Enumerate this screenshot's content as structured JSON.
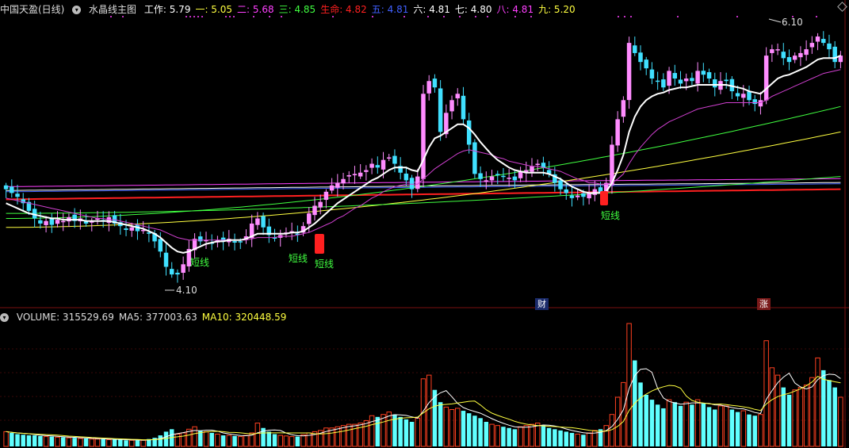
{
  "header": {
    "stock_name": "中国天盈(日线)",
    "indicator_name": "水晶线主图",
    "items": [
      {
        "label": "工作:",
        "value": "5.79",
        "color": "#ffffff"
      },
      {
        "label": "一:",
        "value": "5.05",
        "color": "#ffff40"
      },
      {
        "label": "二:",
        "value": "5.68",
        "color": "#ff40ff"
      },
      {
        "label": "三:",
        "value": "4.85",
        "color": "#40ff40"
      },
      {
        "label": "生命:",
        "value": "4.82",
        "color": "#ff2020"
      },
      {
        "label": "五:",
        "value": "4.81",
        "color": "#4060ff"
      },
      {
        "label": "六:",
        "value": "4.81",
        "color": "#ffffff"
      },
      {
        "label": "七:",
        "value": "4.80",
        "color": "#ffffff"
      },
      {
        "label": "八:",
        "value": "4.81",
        "color": "#ff40ff"
      },
      {
        "label": "九:",
        "value": "5.20",
        "color": "#ffff40"
      }
    ]
  },
  "volume_header": {
    "items": [
      {
        "label": "VOLUME:",
        "value": "315529.69",
        "color": "#dddddd"
      },
      {
        "label": "MA5:",
        "value": "377003.63",
        "color": "#dddddd"
      },
      {
        "label": "MA10:",
        "value": "320448.59",
        "color": "#ffff40"
      }
    ]
  },
  "annotations": {
    "low_label": "4.10",
    "high_label": "6.10",
    "signal_label": "短线",
    "event_cai": "财",
    "event_zhang": "涨"
  },
  "colors": {
    "up": "#ff8cff",
    "down": "#40e0ff",
    "up_volume": "#ff4020",
    "down_volume": "#60ffff",
    "background": "#000000",
    "grid": "#7a1010"
  },
  "chart_data": {
    "type": "candlestick",
    "price_range": [
      4.0,
      6.2
    ],
    "closes": [
      4.85,
      4.82,
      4.79,
      4.74,
      4.68,
      4.62,
      4.58,
      4.6,
      4.57,
      4.61,
      4.6,
      4.63,
      4.6,
      4.62,
      4.58,
      4.6,
      4.62,
      4.6,
      4.63,
      4.58,
      4.56,
      4.53,
      4.55,
      4.52,
      4.53,
      4.5,
      4.44,
      4.36,
      4.24,
      4.18,
      4.18,
      4.26,
      4.38,
      4.46,
      4.44,
      4.45,
      4.43,
      4.45,
      4.44,
      4.46,
      4.43,
      4.44,
      4.48,
      4.58,
      4.62,
      4.55,
      4.49,
      4.47,
      4.49,
      4.51,
      4.52,
      4.5,
      4.56,
      4.66,
      4.72,
      4.75,
      4.83,
      4.88,
      4.9,
      4.93,
      4.96,
      4.97,
      4.98,
      5.0,
      5.05,
      5.02,
      5.08,
      5.1,
      5.05,
      4.98,
      4.92,
      4.85,
      4.95,
      5.6,
      5.7,
      5.65,
      5.3,
      5.45,
      5.55,
      5.6,
      5.4,
      5.2,
      4.97,
      4.93,
      4.92,
      4.95,
      4.96,
      4.95,
      4.94,
      4.92,
      4.99,
      5.0,
      5.03,
      5.05,
      5.02,
      4.97,
      4.9,
      4.85,
      4.82,
      4.78,
      4.8,
      4.79,
      4.82,
      4.85,
      4.82,
      4.9,
      5.2,
      5.4,
      5.55,
      6.0,
      5.92,
      5.85,
      5.8,
      5.72,
      5.7,
      5.65,
      5.78,
      5.72,
      5.68,
      5.72,
      5.7,
      5.78,
      5.75,
      5.72,
      5.65,
      5.7,
      5.7,
      5.62,
      5.58,
      5.6,
      5.55,
      5.52,
      5.55,
      5.9,
      5.95,
      5.95,
      5.88,
      5.85,
      5.9,
      5.92,
      5.95,
      6.0,
      6.05,
      6.0,
      5.95,
      5.85,
      5.9
    ],
    "work_line": [
      4.74,
      4.72,
      4.7,
      4.68,
      4.66,
      4.65,
      4.64,
      4.63,
      4.62,
      4.62,
      4.61,
      4.61,
      4.61,
      4.61,
      4.6,
      4.6,
      4.6,
      4.6,
      4.6,
      4.59,
      4.58,
      4.57,
      4.56,
      4.55,
      4.54,
      4.52,
      4.5,
      4.47,
      4.43,
      4.39,
      4.36,
      4.35,
      4.36,
      4.38,
      4.4,
      4.42,
      4.43,
      4.44,
      4.44,
      4.45,
      4.45,
      4.45,
      4.46,
      4.48,
      4.5,
      4.5,
      4.5,
      4.5,
      4.5,
      4.5,
      4.51,
      4.51,
      4.52,
      4.55,
      4.58,
      4.62,
      4.66,
      4.7,
      4.74,
      4.77,
      4.8,
      4.83,
      4.86,
      4.89,
      4.92,
      4.94,
      4.97,
      5.0,
      5.02,
      5.02,
      5.02,
      5.0,
      4.99,
      5.08,
      5.18,
      5.25,
      5.27,
      5.3,
      5.33,
      5.36,
      5.36,
      5.33,
      5.28,
      5.22,
      5.17,
      5.12,
      5.08,
      5.05,
      5.02,
      5.0,
      4.99,
      4.98,
      4.98,
      4.98,
      4.98,
      4.97,
      4.95,
      4.93,
      4.9,
      4.87,
      4.85,
      4.83,
      4.82,
      4.82,
      4.82,
      4.83,
      4.9,
      5.0,
      5.12,
      5.3,
      5.42,
      5.5,
      5.55,
      5.58,
      5.6,
      5.61,
      5.63,
      5.64,
      5.65,
      5.65,
      5.66,
      5.67,
      5.67,
      5.67,
      5.67,
      5.67,
      5.67,
      5.66,
      5.65,
      5.64,
      5.62,
      5.61,
      5.6,
      5.64,
      5.68,
      5.72,
      5.74,
      5.75,
      5.77,
      5.79,
      5.81,
      5.84,
      5.87,
      5.88,
      5.88,
      5.88,
      5.9
    ],
    "second_line": [
      4.78,
      4.77,
      4.76,
      4.75,
      4.74,
      4.73,
      4.72,
      4.71,
      4.7,
      4.69,
      4.68,
      4.67,
      4.66,
      4.65,
      4.64,
      4.63,
      4.62,
      4.62,
      4.61,
      4.61,
      4.6,
      4.59,
      4.58,
      4.57,
      4.56,
      4.55,
      4.54,
      4.53,
      4.51,
      4.49,
      4.47,
      4.46,
      4.45,
      4.45,
      4.45,
      4.45,
      4.45,
      4.45,
      4.45,
      4.45,
      4.45,
      4.45,
      4.45,
      4.46,
      4.47,
      4.47,
      4.47,
      4.47,
      4.48,
      4.48,
      4.48,
      4.49,
      4.5,
      4.51,
      4.53,
      4.55,
      4.57,
      4.59,
      4.62,
      4.64,
      4.67,
      4.7,
      4.72,
      4.75,
      4.78,
      4.8,
      4.83,
      4.85,
      4.87,
      4.88,
      4.89,
      4.89,
      4.89,
      4.93,
      4.97,
      5.01,
      5.04,
      5.07,
      5.1,
      5.13,
      5.15,
      5.16,
      5.15,
      5.14,
      5.13,
      5.12,
      5.1,
      5.09,
      5.07,
      5.06,
      5.05,
      5.04,
      5.03,
      5.03,
      5.02,
      5.01,
      5.0,
      4.99,
      4.97,
      4.95,
      4.93,
      4.92,
      4.9,
      4.9,
      4.89,
      4.89,
      4.9,
      4.93,
      4.97,
      5.05,
      5.12,
      5.18,
      5.23,
      5.28,
      5.32,
      5.35,
      5.38,
      5.4,
      5.42,
      5.44,
      5.46,
      5.48,
      5.49,
      5.5,
      5.51,
      5.52,
      5.53,
      5.53,
      5.53,
      5.53,
      5.53,
      5.53,
      5.53,
      5.55,
      5.58,
      5.6,
      5.62,
      5.64,
      5.66,
      5.68,
      5.7,
      5.72,
      5.74,
      5.76,
      5.77,
      5.78,
      5.79
    ],
    "volume_range": [
      0,
      1000000
    ],
    "volumes": [
      120000,
      110000,
      100000,
      95000,
      90000,
      90000,
      85000,
      80000,
      80000,
      75000,
      75000,
      70000,
      70000,
      65000,
      65000,
      60000,
      60000,
      60000,
      55000,
      55000,
      55000,
      50000,
      50000,
      50000,
      50000,
      60000,
      70000,
      90000,
      120000,
      140000,
      100000,
      110000,
      140000,
      160000,
      130000,
      120000,
      110000,
      100000,
      90000,
      90000,
      85000,
      80000,
      90000,
      110000,
      190000,
      150000,
      120000,
      100000,
      90000,
      85000,
      80000,
      80000,
      95000,
      110000,
      120000,
      130000,
      150000,
      150000,
      160000,
      170000,
      180000,
      180000,
      190000,
      210000,
      250000,
      240000,
      260000,
      280000,
      260000,
      240000,
      220000,
      200000,
      230000,
      550000,
      580000,
      460000,
      360000,
      320000,
      300000,
      310000,
      290000,
      270000,
      250000,
      230000,
      200000,
      180000,
      170000,
      160000,
      150000,
      140000,
      160000,
      170000,
      180000,
      190000,
      170000,
      150000,
      140000,
      130000,
      120000,
      110000,
      100000,
      95000,
      110000,
      130000,
      140000,
      170000,
      260000,
      400000,
      520000,
      1000000,
      700000,
      520000,
      420000,
      380000,
      340000,
      310000,
      380000,
      360000,
      330000,
      360000,
      340000,
      380000,
      350000,
      320000,
      300000,
      330000,
      330000,
      300000,
      280000,
      290000,
      260000,
      250000,
      260000,
      860000,
      640000,
      580000,
      480000,
      420000,
      460000,
      480000,
      500000,
      560000,
      720000,
      620000,
      540000,
      480000,
      400000
    ]
  }
}
